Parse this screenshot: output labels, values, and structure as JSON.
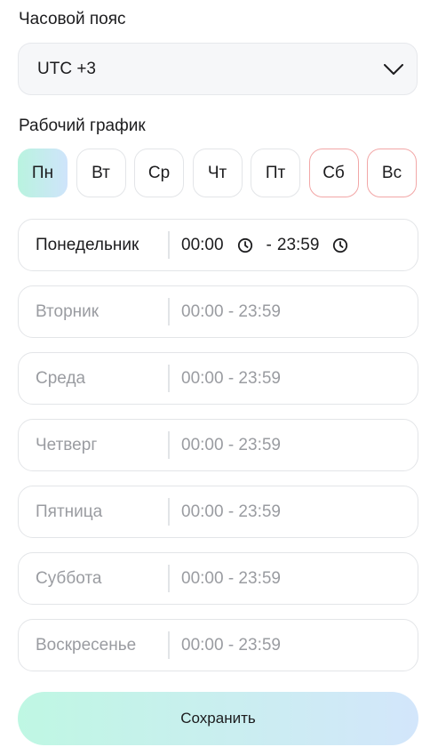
{
  "timezone": {
    "label": "Часовой пояс",
    "value": "UTC +3",
    "icon": "chevron-down-icon"
  },
  "schedule": {
    "label": "Рабочий график",
    "day_buttons": [
      {
        "label": "Пн",
        "state": "active"
      },
      {
        "label": "Вт",
        "state": "normal"
      },
      {
        "label": "Ср",
        "state": "normal"
      },
      {
        "label": "Чт",
        "state": "normal"
      },
      {
        "label": "Пт",
        "state": "normal"
      },
      {
        "label": "Сб",
        "state": "weekend"
      },
      {
        "label": "Вс",
        "state": "weekend"
      }
    ],
    "rows": [
      {
        "day": "Понедельник",
        "start": "00:00",
        "end": "23:59",
        "range": "00:00 - 23:59",
        "active": true
      },
      {
        "day": "Вторник",
        "range": "00:00 - 23:59",
        "active": false
      },
      {
        "day": "Среда",
        "range": "00:00 - 23:59",
        "active": false
      },
      {
        "day": "Четверг",
        "range": "00:00 - 23:59",
        "active": false
      },
      {
        "day": "Пятница",
        "range": "00:00 - 23:59",
        "active": false
      },
      {
        "day": "Суббота",
        "range": "00:00 - 23:59",
        "active": false
      },
      {
        "day": "Воскресенье",
        "range": "00:00 - 23:59",
        "active": false
      }
    ],
    "time_separator": "-"
  },
  "save_button": {
    "label": "Сохранить"
  },
  "colors": {
    "active_gradient_start": "#b9f3df",
    "active_gradient_end": "#cfe4fb",
    "weekend_border": "#f2a7a7",
    "muted_text": "#9a9ca1"
  }
}
